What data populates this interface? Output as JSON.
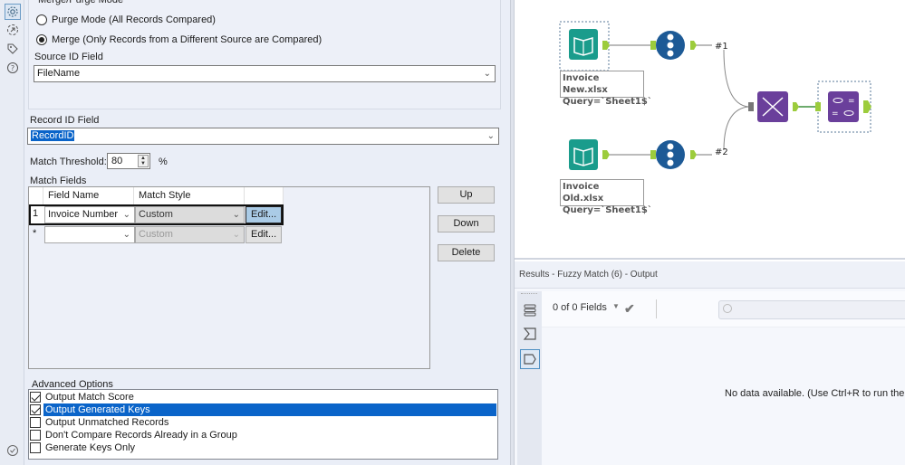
{
  "icon_strip": {
    "icons": [
      "gear-icon",
      "connection-icon",
      "tag-icon",
      "help-icon"
    ],
    "bottom_icon": "check-circle-icon"
  },
  "config": {
    "merge_purge": {
      "title": "Merge/Purge Mode",
      "options": [
        {
          "label": "Purge Mode (All Records Compared)",
          "checked": false
        },
        {
          "label": "Merge (Only Records from a Different Source are Compared)",
          "checked": true
        }
      ],
      "source_id_label": "Source ID Field",
      "source_id_value": "FileName"
    },
    "record_id_label": "Record ID Field",
    "record_id_value": "RecordID",
    "threshold_label": "Match Threshold:",
    "threshold_value": "80",
    "threshold_unit": "%",
    "match_fields": {
      "title": "Match Fields",
      "columns": [
        "Field Name",
        "Match Style"
      ],
      "rows": [
        {
          "index": "1",
          "field": "Invoice Number",
          "style": "Custom",
          "edit": "Edit..."
        },
        {
          "index": "*",
          "field": "",
          "style": "Custom",
          "edit": "Edit..."
        }
      ]
    },
    "buttons": {
      "up": "Up",
      "down": "Down",
      "delete": "Delete"
    },
    "advanced": {
      "title": "Advanced Options",
      "items": [
        {
          "label": "Output Match Score",
          "checked": true,
          "selected": false
        },
        {
          "label": "Output Generated Keys",
          "checked": true,
          "selected": true
        },
        {
          "label": "Output Unmatched Records",
          "checked": false,
          "selected": false
        },
        {
          "label": "Don't Compare Records Already in a Group",
          "checked": false,
          "selected": false
        },
        {
          "label": "Generate Keys Only",
          "checked": false,
          "selected": false
        }
      ]
    }
  },
  "canvas": {
    "nodes": [
      {
        "type": "input-data",
        "line1": "Invoice New.xlsx",
        "line2": "Query=`Sheet1$`"
      },
      {
        "type": "input-data",
        "line1": "Invoice Old.xlsx",
        "line2": "Query=`Sheet1$`"
      }
    ],
    "connections": [
      "#1",
      "#2"
    ],
    "colors": {
      "input": "#1a9c8c",
      "record_id": "#1d5a96",
      "fuzzy": "#6a3f9b",
      "anchor": "#9ccc3c"
    }
  },
  "results": {
    "title": "Results - Fuzzy Match (6) - Output",
    "fields_count": "0 of 0 Fields",
    "search_placeholder": "",
    "no_data": "No data available. (Use Ctrl+R to run the w"
  }
}
